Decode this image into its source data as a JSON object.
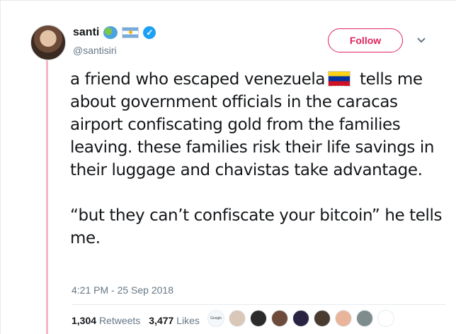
{
  "author": {
    "display_name": "santi",
    "handle": "@santisiri",
    "badges": [
      "globe-icon",
      "argentina-flag-icon",
      "verified-icon"
    ]
  },
  "actions": {
    "follow_label": "Follow"
  },
  "tweet": {
    "text_part1": "a friend who escaped venezuela",
    "text_part1_emoji": "venezuela-flag-icon",
    "text_part2": " tells me about government officials in the caracas airport confiscating gold from the families leaving. these families risk their life savings in their luggage and chavistas take advantage.",
    "text_paragraph2": "“but they can’t confiscate your bitcoin” he tells me.",
    "timestamp": "4:21 PM - 25 Sep 2018"
  },
  "stats": {
    "retweets_count": "1,304",
    "retweets_label": "Retweets",
    "likes_count": "3,477",
    "likes_label": "Likes"
  },
  "likers": [
    {
      "name": "liker-1-avatar",
      "color": "#f5f8fa",
      "text": "Google"
    },
    {
      "name": "liker-2-avatar",
      "color": "#d9c7b8"
    },
    {
      "name": "liker-3-avatar",
      "color": "#2b2b2b"
    },
    {
      "name": "liker-4-avatar",
      "color": "#6e4a3a"
    },
    {
      "name": "liker-5-avatar",
      "color": "#2a2342"
    },
    {
      "name": "liker-6-avatar",
      "color": "#4a3b30"
    },
    {
      "name": "liker-7-avatar",
      "color": "#e8b49a"
    },
    {
      "name": "liker-8-avatar",
      "color": "#7f8c8d"
    },
    {
      "name": "liker-9-avatar",
      "color": "#ffffff"
    }
  ],
  "colors": {
    "thread_line": "#f4b7c4",
    "follow_accent": "#e0245e",
    "secondary_text": "#657786",
    "verified": "#1da1f2"
  }
}
